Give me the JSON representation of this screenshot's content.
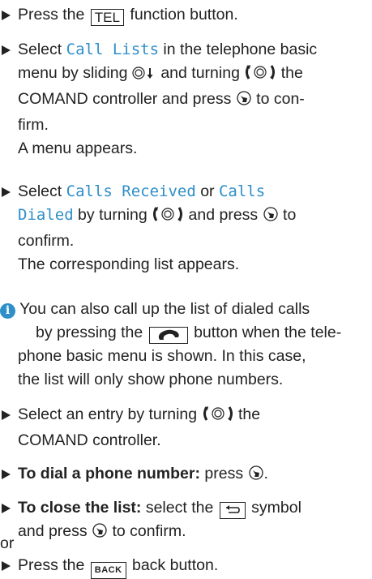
{
  "steps": {
    "s1": {
      "pre": "Press the ",
      "button": "TEL",
      "post": " function button."
    },
    "s2": {
      "pre": "Select ",
      "menu": "Call Lists",
      "mid1": " in the telephone basic",
      "line2a": "menu by sliding ",
      "line2b": " and turning ",
      "line2c": " the",
      "line3a": "COMAND controller and press ",
      "line3b": " to con-",
      "line4": "firm.",
      "result": "A menu appears."
    },
    "s3": {
      "pre": "Select ",
      "menu1": "Calls Received",
      "mid": " or ",
      "menu2a": "Calls",
      "menu2b": "Dialed",
      "line2a": " by turning ",
      "line2b": " and press ",
      "line2c": " to",
      "line3": "confirm.",
      "result": "The corresponding list appears."
    },
    "note": {
      "line1": "You can also call up the list of dialed calls",
      "line2a": "by pressing the ",
      "line2b": " button when the tele-",
      "line3": "phone basic menu is shown. In this case,",
      "line4": "the list will only show phone numbers."
    },
    "s4": {
      "line1a": "Select an entry by turning ",
      "line1b": " the",
      "line2": "COMAND controller."
    },
    "s5": {
      "bold": "To dial a phone number:",
      "post": " press ",
      "end": "."
    },
    "s6": {
      "bold": "To close the list:",
      "mid": " select the ",
      "post": " symbol",
      "line2a": "and press ",
      "line2b": " to confirm."
    },
    "or_text": "or",
    "s7": {
      "pre": "Press the ",
      "button": "BACK",
      "post": " back button."
    }
  },
  "icons": [
    "press-controller-icon",
    "slide-down-icon",
    "turn-controller-icon",
    "phone-handset-icon",
    "back-arrow-icon",
    "info-icon"
  ],
  "colors": {
    "menu_text": "#2e8fc9",
    "info_icon": "#2e8fc9",
    "text": "#222222"
  }
}
